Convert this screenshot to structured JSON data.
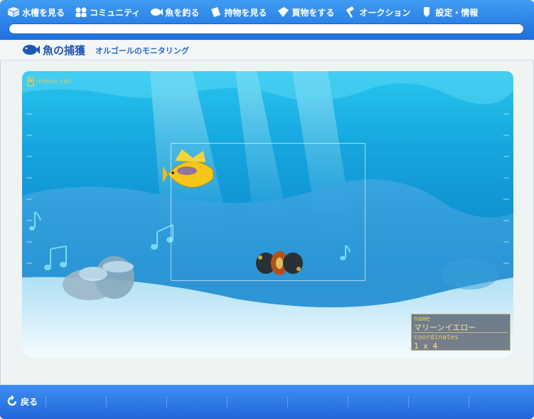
{
  "nav": {
    "items": [
      {
        "label": "水槽を見る",
        "icon": "box-icon"
      },
      {
        "label": "コミュニティ",
        "icon": "people-icon"
      },
      {
        "label": "魚を釣る",
        "icon": "fish-icon"
      },
      {
        "label": "持物を見る",
        "icon": "bag-icon"
      },
      {
        "label": "買物をする",
        "icon": "tag-icon"
      },
      {
        "label": "オークション",
        "icon": "hammer-icon"
      },
      {
        "label": "設定・情報",
        "icon": "info-icon"
      }
    ]
  },
  "page": {
    "title": "魚の捕獲",
    "subtitle": "オルゴールのモニタリング"
  },
  "tank": {
    "mobile_label": "mobile call"
  },
  "info": {
    "name_label": "name",
    "name_value": "マリーンイエロー",
    "coord_label": "coordinates",
    "coord_value": "1 x 4"
  },
  "footer": {
    "back_label": "戻る"
  },
  "colors": {
    "nav_blue": "#2f86ea",
    "title_blue": "#1f55b0",
    "info_text": "#ffd76a"
  }
}
